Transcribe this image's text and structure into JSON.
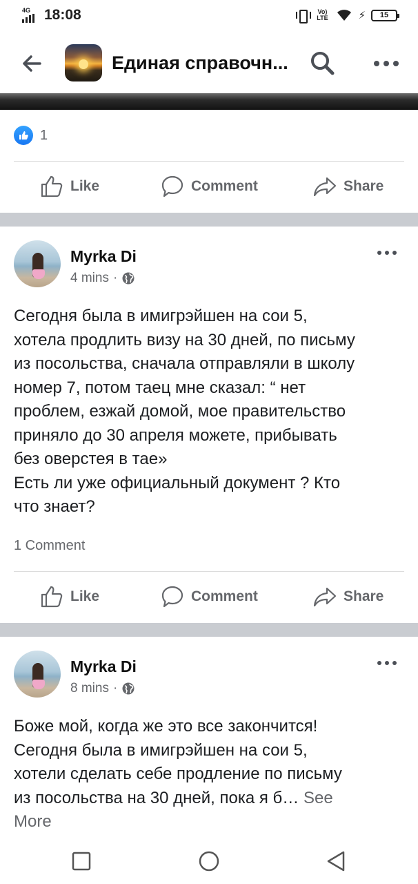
{
  "status_bar": {
    "network": "4G",
    "time": "18:08",
    "volte": "Vo) LTE",
    "battery": "15"
  },
  "header": {
    "title": "Единая справочн...",
    "icons": [
      "back-arrow-icon",
      "group-thumbnail",
      "search-icon",
      "more-icon"
    ]
  },
  "top_post": {
    "reaction_count": "1"
  },
  "actions": {
    "like": "Like",
    "comment": "Comment",
    "share": "Share"
  },
  "posts": [
    {
      "author": "Myrka Di",
      "time": "4 mins",
      "privacy_icon": "globe-icon",
      "text": "Сегодня была в имигрэйшен на сои 5,\nхотела продлить визу на 30 дней, по письму\nиз посольства, сначала отправляли в школу\nномер 7, потом таец мне сказал: “ нет\nпроблем, езжай домой, мое правительство\nприняло до 30 апреля можете, прибывать\nбез оверстея в тае»\nЕсть ли  уже официальный документ ? Кто\nчто знает?",
      "comments": "1 Comment"
    },
    {
      "author": "Myrka Di",
      "time": "8 mins",
      "privacy_icon": "globe-icon",
      "text": "Боже мой, когда же это все закончится!\nСегодня была в имигрэйшен на сои 5,\nхотели сделать себе продление по письму\nиз посольства на 30 дней, пока я б…",
      "see_more": "See\nMore"
    }
  ],
  "colors": {
    "accent": "#1877f2",
    "muted": "#65676b",
    "separator": "#c9ccd1"
  }
}
